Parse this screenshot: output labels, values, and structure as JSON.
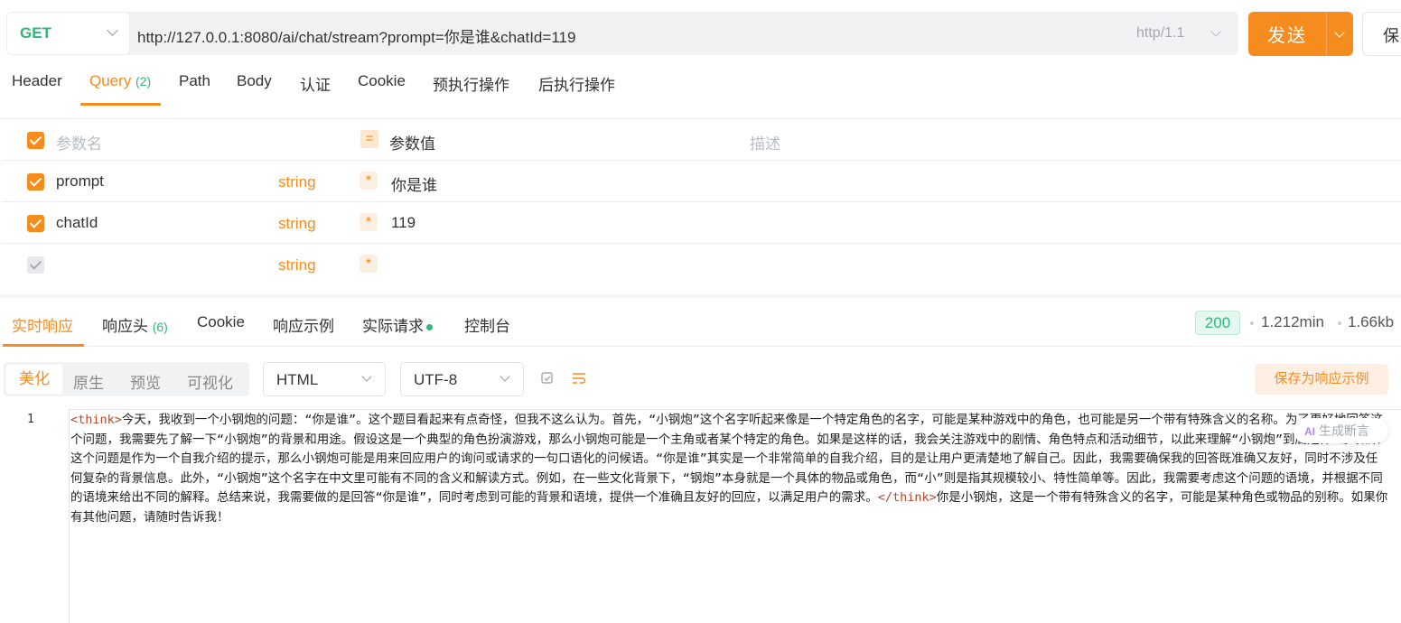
{
  "request": {
    "method": "GET",
    "url": "http://127.0.0.1:8080/ai/chat/stream?prompt=你是谁&chatId=119",
    "protocol": "http/1.1",
    "send_label": "发送",
    "save_label": "保"
  },
  "req_tabs": {
    "header": "Header",
    "query": "Query",
    "query_count": "(2)",
    "path": "Path",
    "body": "Body",
    "auth": "认证",
    "cookie": "Cookie",
    "pre": "预执行操作",
    "post": "后执行操作"
  },
  "params": {
    "header": {
      "name": "参数名",
      "value": "参数值",
      "desc": "描述",
      "eq": "="
    },
    "rows": [
      {
        "name": "prompt",
        "type": "string",
        "value": "你是谁"
      },
      {
        "name": "chatId",
        "type": "string",
        "value": "119"
      },
      {
        "name": "",
        "type": "string",
        "value": ""
      }
    ],
    "required_mark": "*"
  },
  "resp_tabs": {
    "live": "实时响应",
    "headers": "响应头",
    "headers_count": "(6)",
    "cookie": "Cookie",
    "example": "响应示例",
    "actual": "实际请求",
    "console": "控制台"
  },
  "resp_meta": {
    "status": "200",
    "time": "1.212min",
    "size": "1.66kb"
  },
  "format": {
    "beautify": "美化",
    "raw": "原生",
    "preview": "预览",
    "visualize": "可视化",
    "type": "HTML",
    "encoding": "UTF-8",
    "save_example": "保存为响应示例"
  },
  "response": {
    "line_number": "1",
    "open_tag": "<think>",
    "think_text": "今天，我收到一个小钢炮的问题：“你是谁”。这个题目看起来有点奇怪，但我不这么认为。首先，“小钢炮”这个名字听起来像是一个特定角色的名字，可能是某种游戏中的角色，也可能是另一个带有特殊含义的名称。为了更好地回答这个问题，我需要先了解一下“小钢炮”的背景和用途。假设这是一个典型的角色扮演游戏，那么小钢炮可能是一个主角或者某个特定的角色。如果是这样的话，我会关注游戏中的剧情、角色特点和活动细节，以此来理解“小钢炮”到底是什么。如果这个问题是作为一个自我介绍的提示，那么小钢炮可能是用来回应用户的询问或请求的一句口语化的问候语。“你是谁”其实是一个非常简单的自我介绍，目的是让用户更清楚地了解自己。因此，我需要确保我的回答既准确又友好，同时不涉及任何复杂的背景信息。此外，“小钢炮”这个名字在中文里可能有不同的含义和解读方式。例如，在一些文化背景下，“钢炮”本身就是一个具体的物品或角色，而“小”则是指其规模较小、特性简单等。因此，我需要考虑这个问题的语境，并根据不同的语境来给出不同的解释。总结来说，我需要做的是回答“你是谁”，同时考虑到可能的背景和语境，提供一个准确且友好的回应，以满足用户的需求。",
    "close_tag": "</think>",
    "answer_text": "你是小钢炮，这是一个带有特殊含义的名字，可能是某种角色或物品的别称。如果你有其他问题，请随时告诉我！"
  },
  "ai_chip": {
    "badge": "AI",
    "label": "生成断言"
  },
  "colors": {
    "accent": "#f68b1e",
    "success": "#2fb67a"
  }
}
